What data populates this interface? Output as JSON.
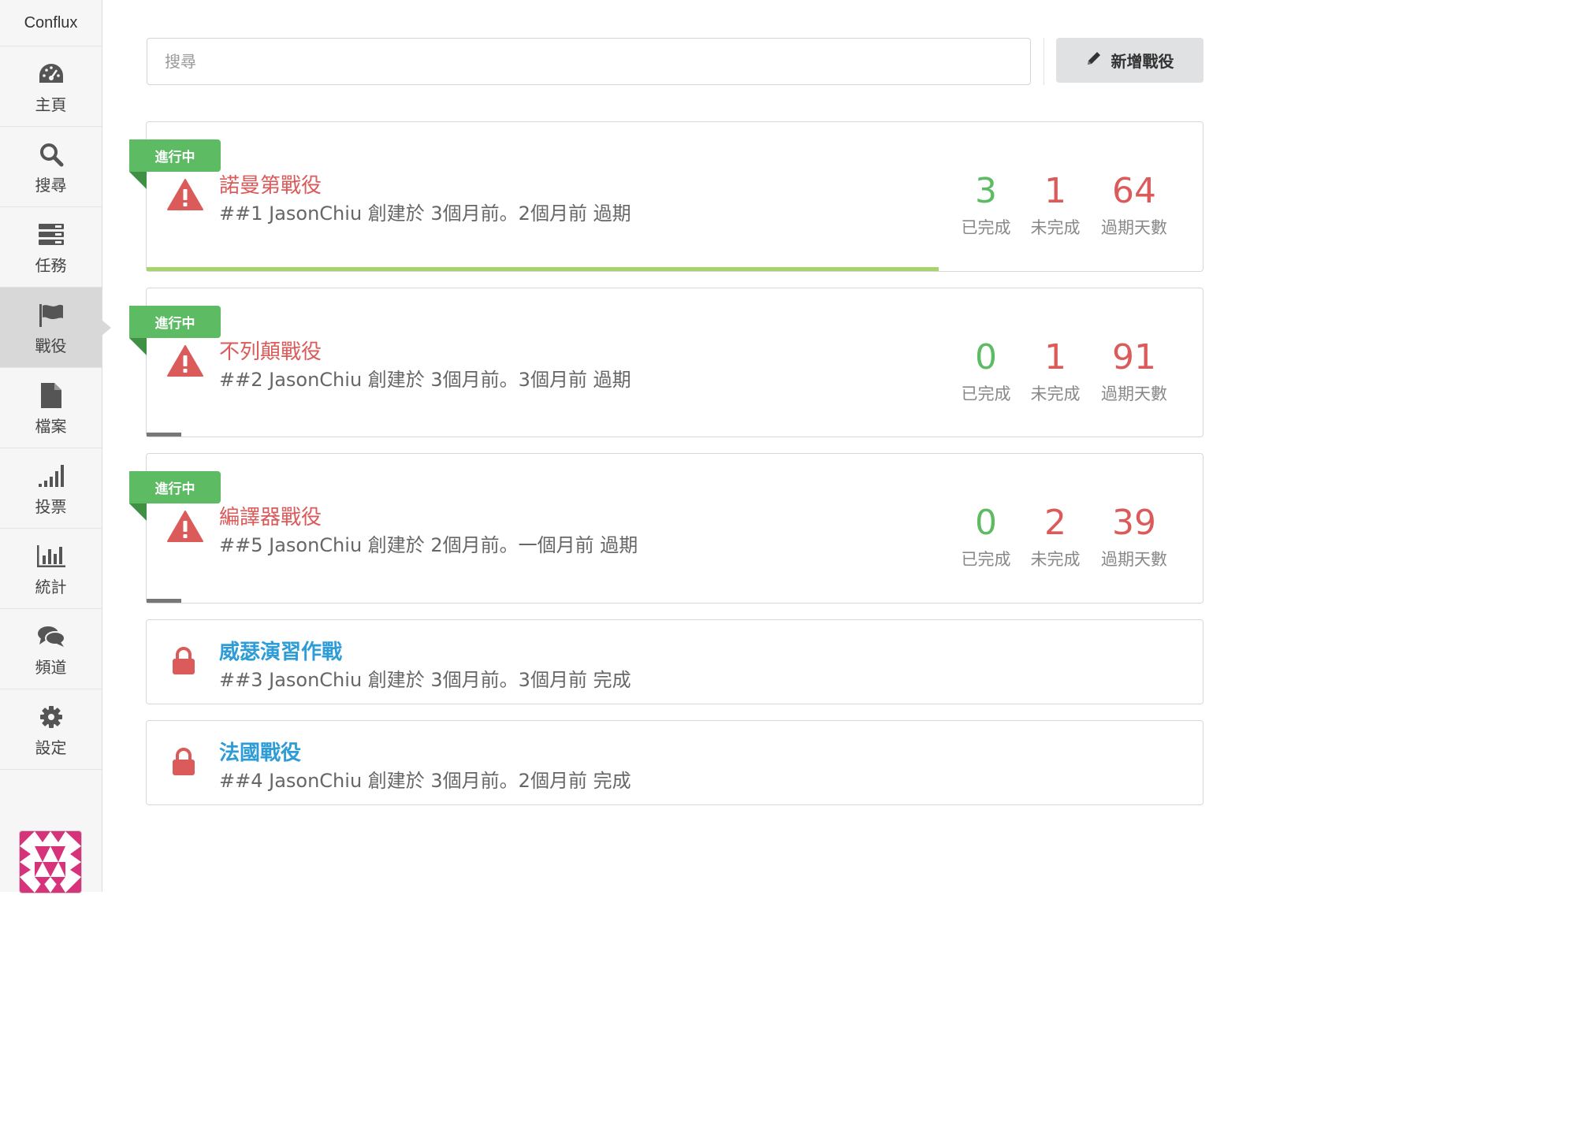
{
  "app": {
    "brand": "Conflux"
  },
  "sidebar": {
    "items": [
      {
        "label": "主頁",
        "icon": "dashboard-icon",
        "active": false
      },
      {
        "label": "搜尋",
        "icon": "search-icon",
        "active": false
      },
      {
        "label": "任務",
        "icon": "tasks-icon",
        "active": false
      },
      {
        "label": "戰役",
        "icon": "flag-icon",
        "active": true
      },
      {
        "label": "檔案",
        "icon": "file-icon",
        "active": false
      },
      {
        "label": "投票",
        "icon": "signal-icon",
        "active": false
      },
      {
        "label": "統計",
        "icon": "bar-chart-icon",
        "active": false
      },
      {
        "label": "頻道",
        "icon": "chat-icon",
        "active": false
      },
      {
        "label": "設定",
        "icon": "gear-icon",
        "active": false
      }
    ]
  },
  "search": {
    "placeholder": "搜尋",
    "value": ""
  },
  "toolbar": {
    "new_campaign_label": "新增戰役"
  },
  "stat_labels": {
    "done": "已完成",
    "undone": "未完成",
    "overdue": "過期天數"
  },
  "colors": {
    "danger": "#db5a5a",
    "success": "#5dbb63",
    "link": "#2e9cd6",
    "progress_good": "#a6d36a",
    "progress_low": "#777777"
  },
  "campaigns": [
    {
      "status": "進行中",
      "title": "諾曼第戰役",
      "meta": "##1 JasonChiu 創建於 3個月前。2個月前 過期",
      "done": "3",
      "undone": "1",
      "overdue_days": "64",
      "progress": 0.75
    },
    {
      "status": "進行中",
      "title": "不列顛戰役",
      "meta": "##2 JasonChiu 創建於 3個月前。3個月前 過期",
      "done": "0",
      "undone": "1",
      "overdue_days": "91",
      "progress": 0.033
    },
    {
      "status": "進行中",
      "title": "編譯器戰役",
      "meta": "##5 JasonChiu 創建於 2個月前。一個月前 過期",
      "done": "0",
      "undone": "2",
      "overdue_days": "39",
      "progress": 0.033
    },
    {
      "title": "威瑟演習作戰",
      "meta": "##3 JasonChiu 創建於 3個月前。3個月前 完成"
    },
    {
      "title": "法國戰役",
      "meta": "##4 JasonChiu 創建於 3個月前。2個月前 完成"
    }
  ]
}
